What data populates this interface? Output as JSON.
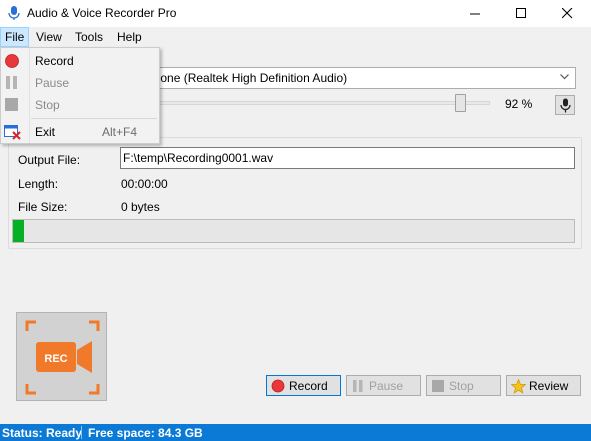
{
  "window": {
    "title": "Audio & Voice Recorder Pro",
    "icon": "microphone-icon"
  },
  "menubar": {
    "items": [
      {
        "label": "File"
      },
      {
        "label": "View"
      },
      {
        "label": "Tools"
      },
      {
        "label": "Help"
      }
    ]
  },
  "file_menu": {
    "items": [
      {
        "label": "Record",
        "icon": "record-icon",
        "enabled": true
      },
      {
        "label": "Pause",
        "icon": "pause-icon",
        "enabled": false
      },
      {
        "label": "Stop",
        "icon": "stop-icon",
        "enabled": false
      },
      {
        "label": "Exit",
        "icon": "exit-icon",
        "shortcut": "Alt+F4",
        "enabled": true
      }
    ]
  },
  "input": {
    "device_partial": "phone (Realtek High Definition Audio)",
    "volume_percent": 92,
    "volume_label": "92 %"
  },
  "recording": {
    "output_label": "Output File:",
    "output_value": "F:\\temp\\Recording0001.wav",
    "length_label": "Length:",
    "length_value": "00:00:00",
    "size_label": "File Size:",
    "size_value": "0 bytes",
    "progress_fraction": 0.02
  },
  "rec_tile": {
    "text": "REC"
  },
  "transport": {
    "record": "Record",
    "pause": "Pause",
    "stop": "Stop",
    "review": "Review"
  },
  "status": {
    "state": "Status: Ready",
    "free_space": "Free space: 84.3 GB"
  },
  "colors": {
    "accent": "#0a7ad6",
    "progress": "#06b025",
    "record": "#e8383a",
    "rec_orange": "#f07a2a"
  }
}
